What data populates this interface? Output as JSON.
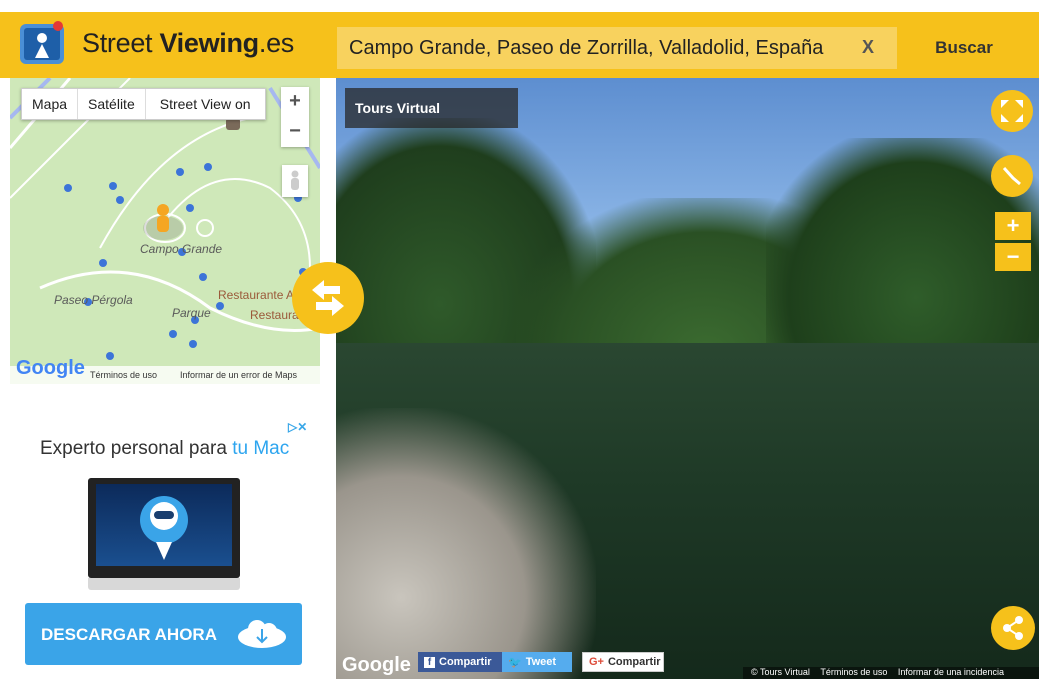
{
  "header": {
    "logo_text_regular": "Street ",
    "logo_text_bold": "Viewing",
    "logo_text_suffix": ".es",
    "search_value": "Campo Grande, Paseo de Zorrilla, Valladolid, España",
    "clear_label": "X",
    "search_button": "Buscar"
  },
  "map": {
    "types": [
      "Mapa",
      "Satélite",
      "Street View on"
    ],
    "zoom_in": "+",
    "zoom_out": "−",
    "labels": {
      "campo_grande": "Campo Grande",
      "paseo_pergola": "Paseo Pérgola",
      "parque": "Parque",
      "restaurante_1": "Restaurante Acu",
      "restaurante_2": "Restaurante"
    },
    "google": "Google",
    "terms": "Términos de uso",
    "report": "Informar de un error de Maps"
  },
  "ad": {
    "title_plain": "Experto personal para ",
    "title_accent": "tu Mac",
    "cta": "DESCARGAR AHORA"
  },
  "pano": {
    "tours_label": "Tours Virtual",
    "zoom_in": "+",
    "zoom_out": "−",
    "google": "Google",
    "share_fb": "Compartir",
    "share_tw": "Tweet",
    "share_gp": "Compartir",
    "footer_copyright": "© Tours Virtual",
    "footer_terms": "Términos de uso",
    "footer_report": "Informar de una incidencia"
  },
  "colors": {
    "brand_yellow": "#f6c11b",
    "ad_blue": "#3aa4e8"
  }
}
